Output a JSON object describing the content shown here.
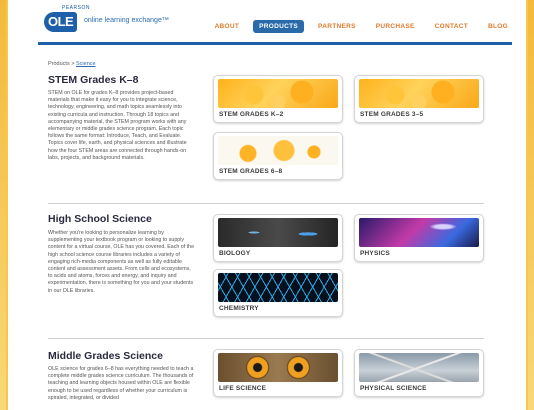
{
  "header": {
    "logo": {
      "publisher": "PEARSON",
      "mark": "OLE",
      "tagline": "online learning exchange™"
    },
    "nav": [
      {
        "label": "ABOUT",
        "active": false
      },
      {
        "label": "PRODUCTS",
        "active": true
      },
      {
        "label": "PARTNERS",
        "active": false
      },
      {
        "label": "PURCHASE",
        "active": false
      },
      {
        "label": "CONTACT",
        "active": false
      },
      {
        "label": "BLOG",
        "active": false
      }
    ]
  },
  "breadcrumb": {
    "home": "Products",
    "separator": ">",
    "current": "Science"
  },
  "sections": [
    {
      "title": "STEM Grades K–8",
      "description": "STEM on OLE for grades K–8 provides project-based materials that make it easy for you to integrate science, technology, engineering, and math topics seamlessly into existing curricula and instruction. Through 18 topics and accompanying material, the STEM program works with any elementary or middle grades science program. Each topic follows the same format: Introduce, Teach, and Evaluate. Topics cover life, earth, and physical sciences and illustrate how the four STEM areas are connected through hands-on labs, projects, and background materials.",
      "cards": [
        {
          "label": "STEM GRADES K–2"
        },
        {
          "label": "STEM GRADES 3–5"
        },
        {
          "label": "STEM GRADES 6–8"
        }
      ]
    },
    {
      "title": "High School Science",
      "description": "Whether you're looking to personalize learning by supplementing your textbook program or looking to supply content for a virtual course, OLE has you covered. Each of the high school science course libraries includes a variety of engaging rich-media components as well as fully editable content and assessment assets. From cells and ecosystems, to acids and atoms, forces and energy, and inquiry and experimentation, there is something for you and your students in our OLE libraries.",
      "cards": [
        {
          "label": "BIOLOGY"
        },
        {
          "label": "PHYSICS"
        },
        {
          "label": "CHEMISTRY"
        }
      ]
    },
    {
      "title": "Middle Grades Science",
      "description": "OLE science for grades 6–8 has everything needed to teach a complete middle grades science curriculum. The thousands of teaching and learning objects housed within OLE are flexible enough to be used regardless of whether your curriculum is spiraled, integrated, or divided",
      "cards": [
        {
          "label": "LIFE SCIENCE"
        },
        {
          "label": "PHYSICAL SCIENCE"
        }
      ]
    }
  ]
}
